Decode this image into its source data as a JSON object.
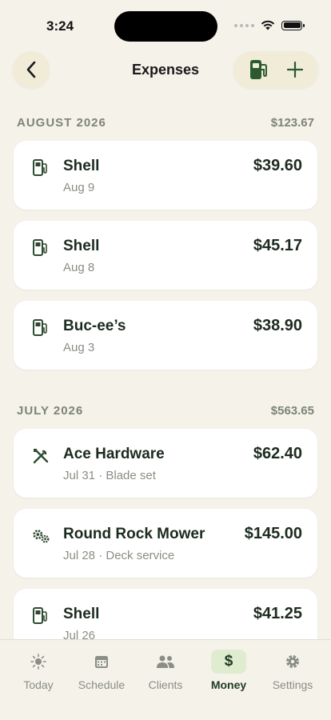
{
  "status": {
    "time": "3:24"
  },
  "header": {
    "title": "Expenses"
  },
  "sections": [
    {
      "title": "AUGUST 2026",
      "total": "$123.67",
      "items": [
        {
          "icon": "gas-pump-icon",
          "name": "Shell",
          "sub": "Aug 9",
          "amount": "$39.60"
        },
        {
          "icon": "gas-pump-icon",
          "name": "Shell",
          "sub": "Aug 8",
          "amount": "$45.17"
        },
        {
          "icon": "gas-pump-icon",
          "name": "Buc-ee’s",
          "sub": "Aug 3",
          "amount": "$38.90"
        }
      ]
    },
    {
      "title": "JULY 2026",
      "total": "$563.65",
      "items": [
        {
          "icon": "tools-icon",
          "name": "Ace Hardware",
          "sub": "Jul 31 · Blade set",
          "amount": "$62.40"
        },
        {
          "icon": "gears-icon",
          "name": "Round Rock Mower",
          "sub": "Jul 28 · Deck service",
          "amount": "$145.00"
        },
        {
          "icon": "gas-pump-icon",
          "name": "Shell",
          "sub": "Jul 26",
          "amount": "$41.25"
        }
      ]
    }
  ],
  "tabs": [
    {
      "label": "Today",
      "icon": "sun-icon",
      "active": false
    },
    {
      "label": "Schedule",
      "icon": "calendar-icon",
      "active": false
    },
    {
      "label": "Clients",
      "icon": "people-icon",
      "active": false
    },
    {
      "label": "Money",
      "icon": "dollar-icon",
      "active": true
    },
    {
      "label": "Settings",
      "icon": "gear-icon",
      "active": false
    }
  ],
  "colors": {
    "accent": "#1f3a23",
    "active_tab_bg": "#dfeccf",
    "background": "#f5f2ea",
    "muted": "#8a8e85"
  }
}
